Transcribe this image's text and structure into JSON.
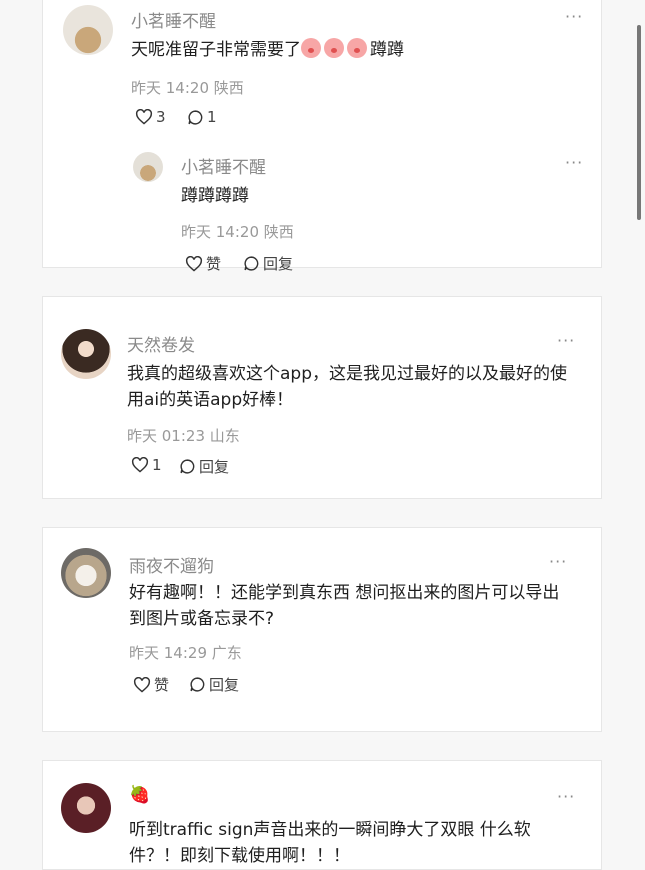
{
  "comments": [
    {
      "user": "小茗睡不醒",
      "text": "天呢准留子非常需要了",
      "emoji_suffix": "蹲蹲",
      "meta": "昨天 14:20 陕西",
      "likes": "3",
      "replies": "1",
      "reply": {
        "user": "小茗睡不醒",
        "text": "蹲蹲蹲蹲",
        "meta": "昨天 14:20 陕西",
        "like_label": "赞",
        "reply_label": "回复"
      }
    },
    {
      "user": "天然卷发",
      "text": "我真的超级喜欢这个app，这是我见过最好的以及最好的使用ai的英语app好棒！",
      "meta": "昨天 01:23 山东",
      "likes": "1",
      "reply_label": "回复"
    },
    {
      "user": "雨夜不遛狗",
      "text": "好有趣啊！！还能学到真东西 想问抠出来的图片可以导出到图片或备忘录不?",
      "meta": "昨天 14:29 广东",
      "like_label": "赞",
      "reply_label": "回复"
    },
    {
      "user": "🍓",
      "text": "听到traffic sign声音出来的一瞬间睁大了双眼 什么软件？！即刻下载使用啊！！！"
    }
  ],
  "more_label": "···",
  "icons": {
    "like": "heart-outline-icon",
    "comment": "speech-bubble-icon"
  }
}
